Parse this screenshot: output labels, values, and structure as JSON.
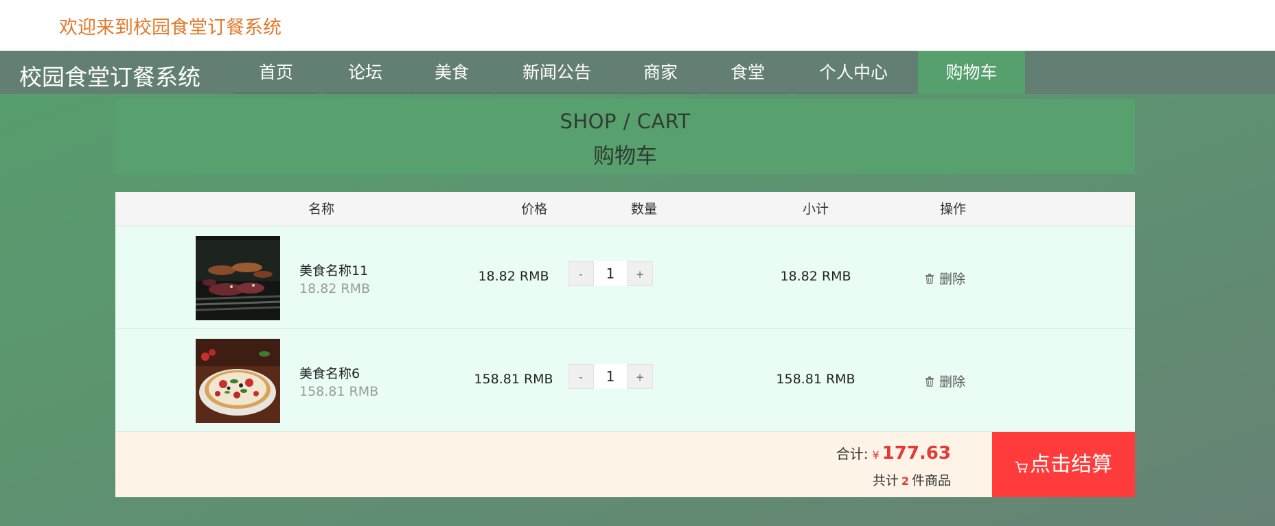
{
  "topbar": {
    "welcome": "欢迎来到校园食堂订餐系统"
  },
  "navbar": {
    "brand": "校园食堂订餐系统",
    "items": [
      {
        "label": "首页"
      },
      {
        "label": "论坛"
      },
      {
        "label": "美食"
      },
      {
        "label": "新闻公告"
      },
      {
        "label": "商家"
      },
      {
        "label": "食堂"
      },
      {
        "label": "个人中心"
      },
      {
        "label": "购物车"
      }
    ],
    "active": "购物车"
  },
  "page_header": {
    "en": "SHOP / CART",
    "cn": "购物车"
  },
  "table": {
    "headers": {
      "name": "名称",
      "price": "价格",
      "qty": "数量",
      "subtotal": "小计",
      "action": "操作"
    },
    "rows": [
      {
        "name": "美食名称11",
        "unit_price_sub": "18.82 RMB",
        "price": "18.82 RMB",
        "qty": "1",
        "subtotal": "18.82 RMB",
        "delete_label": "删除",
        "image_icon": "grilled-meat-image"
      },
      {
        "name": "美食名称6",
        "unit_price_sub": "158.81 RMB",
        "price": "158.81 RMB",
        "qty": "1",
        "subtotal": "158.81 RMB",
        "delete_label": "删除",
        "image_icon": "pizza-image"
      }
    ],
    "qty_minus": "-",
    "qty_plus": "+"
  },
  "summary": {
    "total_label": "合计:",
    "currency": "¥",
    "total": "177.63",
    "count_prefix": "共计",
    "count": "2",
    "count_suffix": "件商品",
    "checkout_label": "点击结算"
  },
  "colors": {
    "accent_orange": "#e4792a",
    "nav_bg": "#637f73",
    "active_green": "#56a06d",
    "price_red": "#e53935",
    "checkout_red": "#ff3b3b"
  }
}
